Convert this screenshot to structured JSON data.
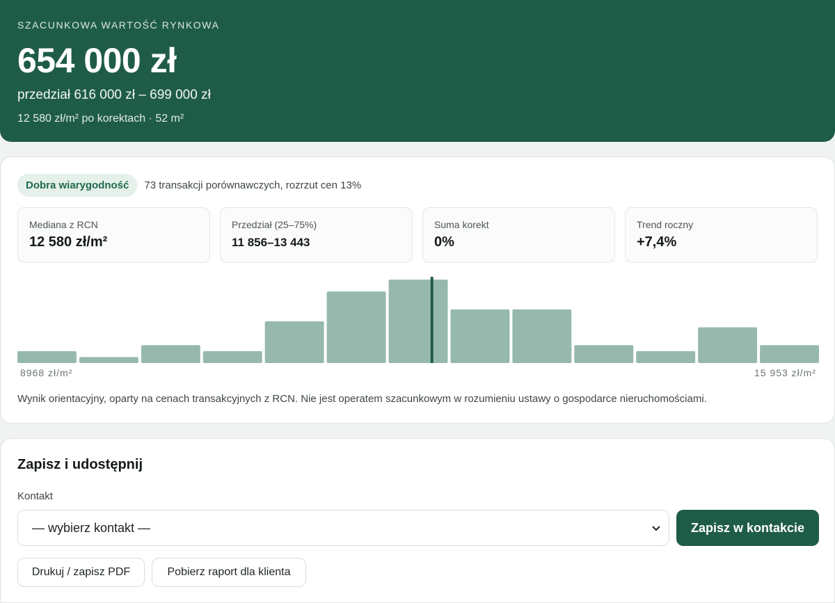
{
  "hero": {
    "eyebrow": "SZACUNKOWA WARTOŚĆ RYNKOWA",
    "price": "654 000 zł",
    "range": "przedział 616 000 zł – 699 000 zł",
    "per_meter": "12 580 zł/m² po korektach · 52 m²"
  },
  "analysis": {
    "badge": "Dobra wiarygodność",
    "note": "73 transakcji porównawczych, rozrzut cen 13%",
    "stats": [
      {
        "label": "Mediana z RCN",
        "value": "12 580 zł/m²"
      },
      {
        "label": "Przedział (25–75%)",
        "value": "11 856–13 443"
      },
      {
        "label": "Suma korekt",
        "value": "0%"
      },
      {
        "label": "Trend roczny",
        "value": "+7,4%"
      }
    ],
    "axis_min": "8968 zł/m²",
    "axis_max": "15 953 zł/m²",
    "disclaimer": "Wynik orientacyjny, oparty na cenach transakcyjnych z RCN. Nie jest operatem szacunkowym w rozumieniu ustawy o gospodarce nieruchomościami."
  },
  "chart_data": {
    "type": "bar",
    "x_range": [
      8968,
      15953
    ],
    "values": [
      2,
      1,
      3,
      2,
      7,
      12,
      14,
      9,
      9,
      3,
      2,
      6,
      3
    ],
    "marker_value": 12580,
    "bar_color": "#97b9ad",
    "marker_color": "#1f5c48"
  },
  "save": {
    "title": "Zapisz i udostępnij",
    "contact_label": "Kontakt",
    "select_value": "— wybierz kontakt —",
    "save_button": "Zapisz w kontakcie",
    "pdf_button": "Drukuj / zapisz PDF",
    "report_button": "Pobierz raport dla klienta"
  }
}
